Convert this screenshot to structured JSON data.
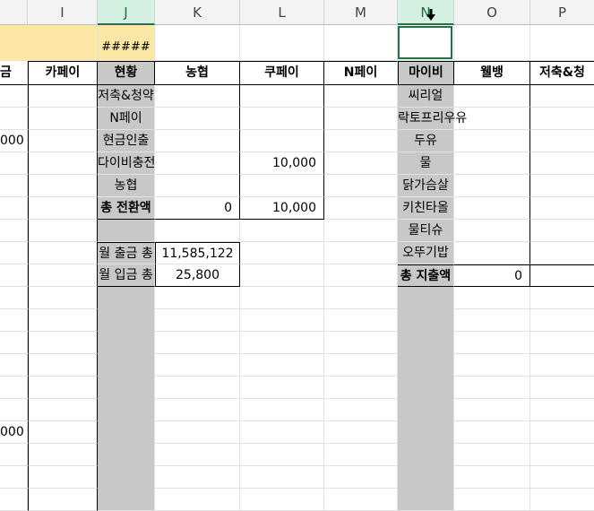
{
  "columns": {
    "H": "",
    "I": "I",
    "J": "J",
    "K": "K",
    "L": "L",
    "M": "M",
    "N": "N",
    "O": "O",
    "P": "P"
  },
  "row2": {
    "J": "#####"
  },
  "headers": {
    "H": "금",
    "I": "카페이",
    "J": "현황",
    "K": "농협",
    "L": "쿠페이",
    "M": "N페이",
    "N": "마이비",
    "O": "웰뱅",
    "P": "저축&청"
  },
  "j_items": [
    "저축&청약",
    "N페이",
    "현금인출",
    "다이비충전",
    "농협",
    "총 전환액",
    "",
    "월 출금 총",
    "월 입금 총"
  ],
  "k_values": [
    "",
    "",
    "",
    "",
    "",
    "0",
    "",
    "11,585,122",
    "25,800"
  ],
  "l_values": [
    "",
    "",
    "",
    "10,000",
    "",
    "10,000"
  ],
  "n_items": [
    "씨리얼",
    "락토프리우유",
    "두유",
    "물",
    "닭가슴살",
    "키친타올",
    "물티슈",
    "오뚜기밥",
    "총 지출액"
  ],
  "o_values": [
    "",
    "",
    "",
    "",
    "",
    "",
    "",
    "",
    "0"
  ],
  "h_values": [
    "",
    "",
    "000",
    "",
    "",
    "",
    "",
    "",
    "",
    "",
    "",
    "",
    "",
    "",
    "",
    "000"
  ]
}
